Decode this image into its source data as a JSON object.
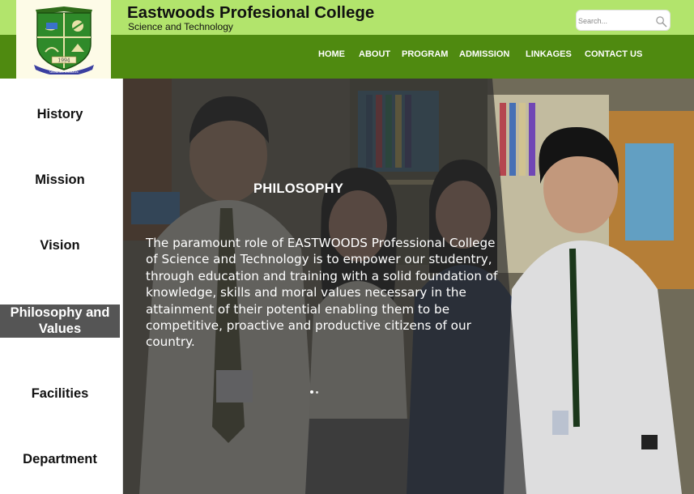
{
  "header": {
    "title": "Eastwoods Profesional College",
    "subtitle": "Science and Technology",
    "logo_icon": "college-seal-icon",
    "logo_text": "1994",
    "logo_motto": "GENESIS EXODUS"
  },
  "search": {
    "placeholder": "Search...",
    "icon": "search-icon"
  },
  "nav": {
    "items": [
      {
        "label": "HOME"
      },
      {
        "label": "ABOUT"
      },
      {
        "label": "PROGRAM"
      },
      {
        "label": "ADMISSION"
      },
      {
        "label": "LINKAGES"
      },
      {
        "label": "CONTACT US"
      }
    ]
  },
  "sidebar": {
    "items": [
      {
        "label": "History"
      },
      {
        "label": "Mission"
      },
      {
        "label": "Vision"
      },
      {
        "label": "Philosophy and Values",
        "active": true
      },
      {
        "label": "Facilities"
      },
      {
        "label": "Department"
      }
    ]
  },
  "hero": {
    "title": "PHILOSOPHY",
    "body": "The paramount role of EASTWOODS Professional College of Science and Technology is to empower our studentry, through education and training with a solid foundation of knowledge, skills and moral values necessary in the attainment of their potential enabling them to be competitive, proactive and productive citizens of our country."
  },
  "colors": {
    "top_bar": "#b2e46c",
    "nav_bar": "#4f8a10",
    "active_item": "#555555",
    "overlay": "#2b2b2b"
  }
}
